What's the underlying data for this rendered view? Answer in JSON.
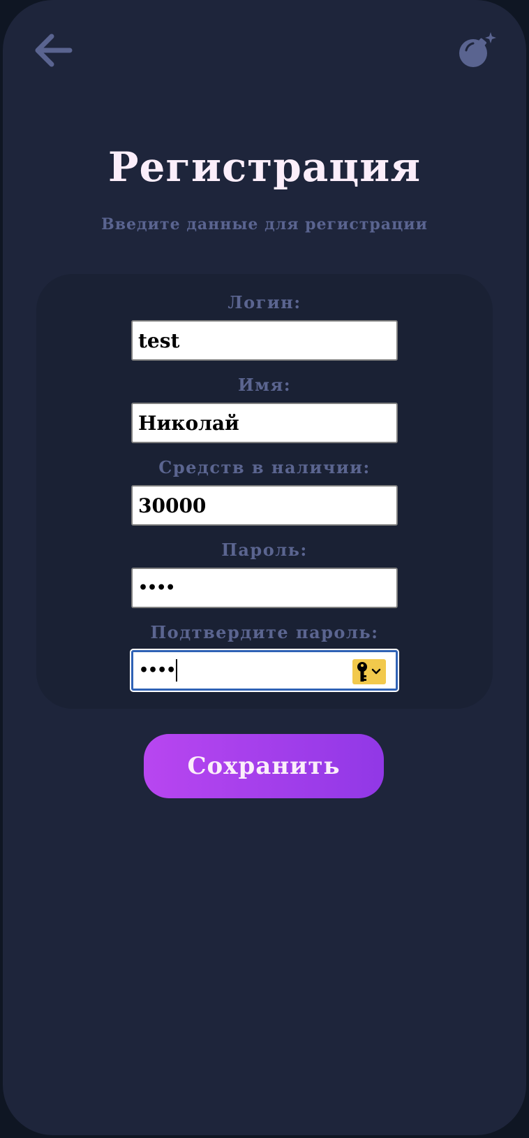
{
  "header": {
    "back_icon": "arrow-left-icon",
    "bomb_icon": "bomb-icon"
  },
  "title": "Регистрация",
  "subtitle": "Введите данные для регистрации",
  "form": {
    "login": {
      "label": "Логин:",
      "value": "test"
    },
    "name": {
      "label": "Имя:",
      "value": "Николай"
    },
    "funds": {
      "label": "Средств в наличии:",
      "value": "30000"
    },
    "password": {
      "label": "Пароль:",
      "value": "••••"
    },
    "confirm_password": {
      "label": "Подтвердите пароль:",
      "value": "••••",
      "autofill_icon": "key-icon"
    }
  },
  "save_button": {
    "label": "Сохранить"
  },
  "colors": {
    "background": "#1e253b",
    "card": "#1a2134",
    "title": "#fbeefa",
    "label": "#5b6590",
    "accent_start": "#b846f0",
    "accent_end": "#9138e6",
    "icon": "#5a6490",
    "focus_border": "#2f62b5",
    "autofill": "#f2c94c"
  }
}
